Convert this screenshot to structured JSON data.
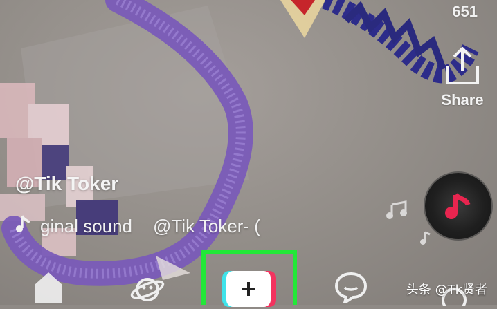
{
  "video": {
    "count": "651",
    "username": "@Tik Toker",
    "sound_prefix_icon": "music-note-icon",
    "sound_title": "ginal sound",
    "sound_author": "@Tik Toker- (",
    "colors": {
      "disc_note": "#e8254f"
    }
  },
  "actions": {
    "share_label": "Share",
    "share_icon": "share-icon"
  },
  "nav": {
    "items": [
      {
        "icon": "home-icon"
      },
      {
        "icon": "discover-icon"
      },
      {
        "icon": "plus-icon"
      },
      {
        "icon": "inbox-icon"
      },
      {
        "icon": "profile-icon"
      }
    ],
    "create_label": "+",
    "highlight_color": "#22e838",
    "create_colors": [
      "#3fe3ea",
      "#ffffff",
      "#f3335f"
    ]
  },
  "watermark": "头条 @Tk贤者"
}
